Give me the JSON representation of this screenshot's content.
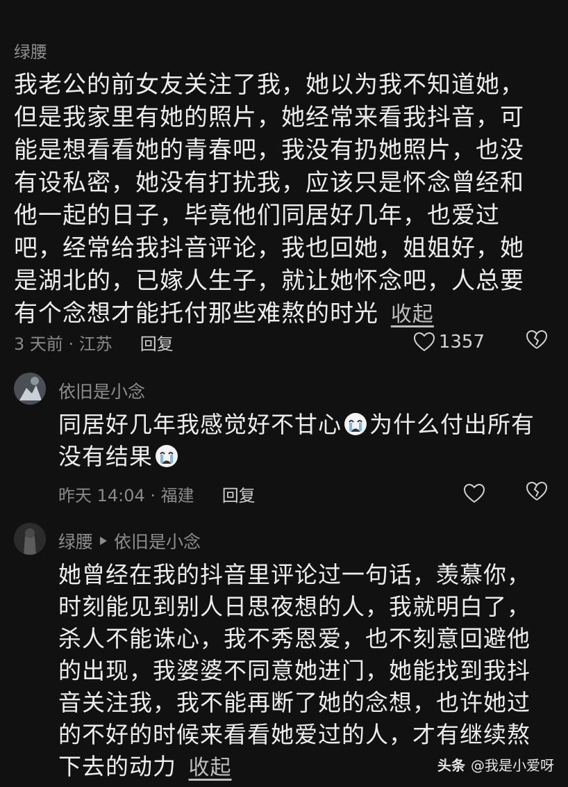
{
  "comment1": {
    "author": "绿腰",
    "text": "我老公的前女友关注了我，她以为我不知道她，但是我家里有她的照片，她经常来看我抖音，可能是想看看她的青春吧，我没有扔她照片，也没有设私密，她没有打扰我，应该只是怀念曾经和他一起的日子，毕竟他们同居好几年，也爱过吧，经常给我抖音评论，我也回她，姐姐好，她是湖北的，已嫁人生子，就让她怀念吧，人总要有个念想才能托付那些难熬的时光",
    "collapse_label": "收起",
    "time_location": "3 天前 · 江苏",
    "reply_label": "回复",
    "like_count": "1357"
  },
  "reply1": {
    "author": "依旧是小念",
    "text_part1": "同居好几年我感觉好不甘心",
    "text_part2": "为什么付出所有没有结果",
    "time_location": "昨天 14:04 · 福建",
    "reply_label": "回复"
  },
  "reply2": {
    "author": "绿腰",
    "reply_to": "依旧是小念",
    "text": "她曾经在我的抖音里评论过一句话，羡慕你，时刻能见到别人日思夜想的人，我就明白了，杀人不能诛心，我不秀恩爱，也不刻意回避他的出现，我婆婆不同意她进门，她能找到我抖音关注我，我不能再断了她的念想，也许她过的不好的时候来看看她爱过的人，才有继续熬下去的动力",
    "collapse_label": "收起"
  },
  "watermark": {
    "brand": "头条",
    "handle": "@我是小爱呀"
  },
  "icons": [
    "heart-icon",
    "broken-heart-icon",
    "crying-emoji-icon",
    "triangle-right-icon"
  ]
}
